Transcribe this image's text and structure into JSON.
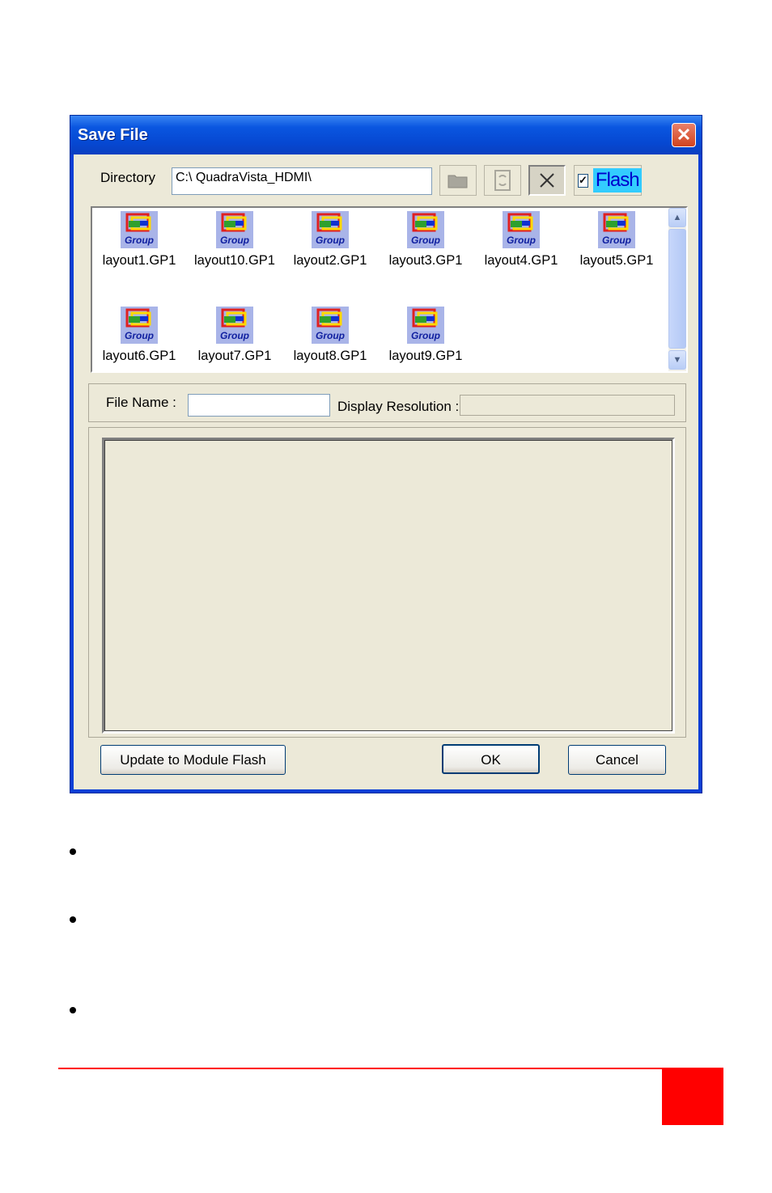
{
  "dialog": {
    "title": "Save File",
    "close_glyph": "✕",
    "directory_label": "Directory",
    "directory_value": "C:\\ QuadraVista_HDMI\\",
    "toolbar": {
      "open_icon": "folder-icon",
      "refresh_icon": "refresh-icon",
      "delete_icon": "close-x-icon",
      "flash_checked": true,
      "flash_check_glyph": "✓",
      "flash_label": "Flash"
    },
    "files": [
      {
        "name": "layout1.GP1",
        "icon": "group-file-icon"
      },
      {
        "name": "layout10.GP1",
        "icon": "group-file-icon"
      },
      {
        "name": "layout2.GP1",
        "icon": "group-file-icon"
      },
      {
        "name": "layout3.GP1",
        "icon": "group-file-icon"
      },
      {
        "name": "layout4.GP1",
        "icon": "group-file-icon"
      },
      {
        "name": "layout5.GP1",
        "icon": "group-file-icon"
      },
      {
        "name": "layout6.GP1",
        "icon": "group-file-icon"
      },
      {
        "name": "layout7.GP1",
        "icon": "group-file-icon"
      },
      {
        "name": "layout8.GP1",
        "icon": "group-file-icon"
      },
      {
        "name": "layout9.GP1",
        "icon": "group-file-icon"
      }
    ],
    "icon_text": "Group",
    "file_name_label": "File Name :",
    "file_name_value": "",
    "display_resolution_label": "Display Resolution :",
    "display_resolution_value": "",
    "buttons": {
      "update": "Update to Module Flash",
      "ok": "OK",
      "cancel": "Cancel"
    }
  },
  "colors": {
    "accent_red": "#ff0000",
    "title_blue": "#0a56e0",
    "dialog_bg": "#ece9d8"
  }
}
